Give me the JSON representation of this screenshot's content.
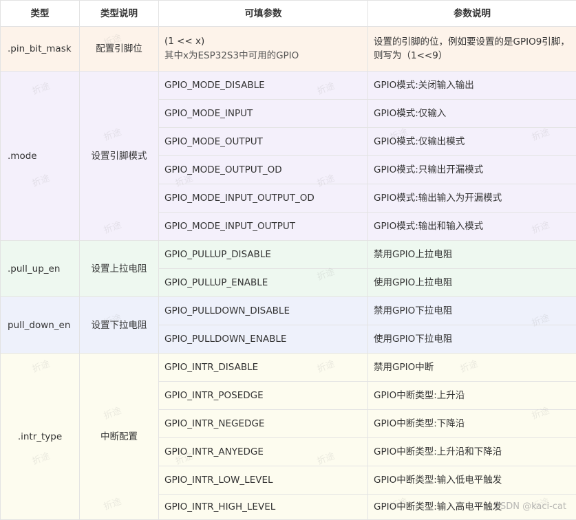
{
  "header": {
    "col1": "类型",
    "col2": "类型说明",
    "col3": "可填参数",
    "col4": "参数说明"
  },
  "groups": {
    "pin_bit_mask": {
      "type": ".pin_bit_mask",
      "desc": "配置引脚位",
      "param_line1": "(1 << x)",
      "param_line2": "其中x为ESP32S3中可用的GPIO",
      "param_desc": "设置的引脚的位，例如要设置的是GPIO9引脚，则写为（1<<9）"
    },
    "mode": {
      "type": ".mode",
      "desc": "设置引脚模式",
      "rows": [
        {
          "param": "GPIO_MODE_DISABLE",
          "desc": "GPIO模式:关闭输入输出"
        },
        {
          "param": "GPIO_MODE_INPUT",
          "desc": "GPIO模式:仅输入"
        },
        {
          "param": "GPIO_MODE_OUTPUT",
          "desc": "GPIO模式:仅输出模式"
        },
        {
          "param": "GPIO_MODE_OUTPUT_OD",
          "desc": "GPIO模式:只输出开漏模式"
        },
        {
          "param": "GPIO_MODE_INPUT_OUTPUT_OD",
          "desc": "GPIO模式:输出输入为开漏模式"
        },
        {
          "param": "GPIO_MODE_INPUT_OUTPUT",
          "desc": "GPIO模式:输出和输入模式"
        }
      ]
    },
    "pull_up_en": {
      "type": ".pull_up_en",
      "desc": "设置上拉电阻",
      "rows": [
        {
          "param": "GPIO_PULLUP_DISABLE",
          "desc": "禁用GPIO上拉电阻"
        },
        {
          "param": "GPIO_PULLUP_ENABLE",
          "desc": "使用GPIO上拉电阻"
        }
      ]
    },
    "pull_down_en": {
      "type": "pull_down_en",
      "desc": "设置下拉电阻",
      "rows": [
        {
          "param": "GPIO_PULLDOWN_DISABLE",
          "desc": "禁用GPIO下拉电阻"
        },
        {
          "param": "GPIO_PULLDOWN_ENABLE",
          "desc": "使用GPIO下拉电阻"
        }
      ]
    },
    "intr_type": {
      "type": ".intr_type",
      "desc": "中断配置",
      "rows": [
        {
          "param": "GPIO_INTR_DISABLE",
          "desc": "禁用GPIO中断"
        },
        {
          "param": "GPIO_INTR_POSEDGE",
          "desc": "GPIO中断类型:上升沿"
        },
        {
          "param": "GPIO_INTR_NEGEDGE",
          "desc": "GPIO中断类型:下降沿"
        },
        {
          "param": "GPIO_INTR_ANYEDGE",
          "desc": "GPIO中断类型:上升沿和下降沿"
        },
        {
          "param": "GPIO_INTR_LOW_LEVEL",
          "desc": "GPIO中断类型:输入低电平触发"
        },
        {
          "param": "GPIO_INTR_HIGH_LEVEL",
          "desc": "GPIO中断类型:输入高电平触发"
        }
      ]
    }
  },
  "watermark": {
    "text": "折途",
    "corner": "CSDN @kaci-cat"
  },
  "colors": {
    "mask_bg": "#fdf3ea",
    "mode_bg": "#f4f0fb",
    "pullup_bg": "#eef8f0",
    "pulldown_bg": "#eef1fb",
    "intr_bg": "#fdfcef",
    "border": "#e3e3e3"
  }
}
